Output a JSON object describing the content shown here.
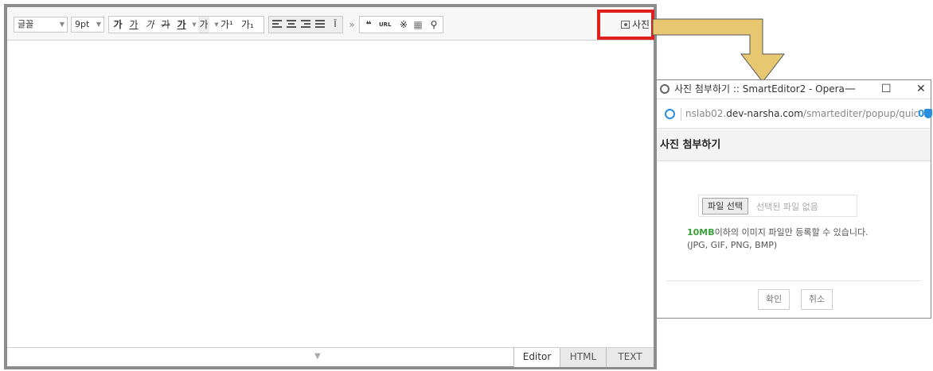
{
  "toolbar": {
    "font_select": "글꼴",
    "size_select": "9pt",
    "bold": "가",
    "underline": "가",
    "italic": "가",
    "strike": "가",
    "font_color": "가",
    "highlight": "가",
    "superscript": "가¹",
    "subscript": "가₁",
    "more": "»",
    "quote": "❝",
    "url": "URL",
    "special_char": "※",
    "table": "▦",
    "find": "⚲",
    "photo_label": "사진"
  },
  "editor": {
    "modes": [
      "Editor",
      "HTML",
      "TEXT"
    ],
    "active_mode": "Editor",
    "resize_grip": "▼"
  },
  "popup": {
    "window_title": "사진 첨부하기 :: SmartEditor2 - Opera",
    "win_min": "—",
    "win_max": "☐",
    "win_close": "✕",
    "url_prefix": "nslab02.",
    "url_domain": "dev-narsha.com",
    "url_path": "/smartediter/popup/quic",
    "badge_count": "0",
    "header": "사진 첨부하기",
    "file_button": "파일 선택",
    "no_file": "선택된 파일 없음",
    "size_limit_bold": "10MB",
    "size_limit_text": "이하의 이미지 파일만 등록할 수 있습니다.",
    "formats": "(JPG, GIF, PNG, BMP)",
    "confirm_button": "확인",
    "cancel_button": "취소"
  },
  "colors": {
    "highlight_border": "#e0201d",
    "arrow_fill": "#e8c771",
    "size_green": "#3aa13a",
    "link_blue": "#2a8ee0"
  }
}
